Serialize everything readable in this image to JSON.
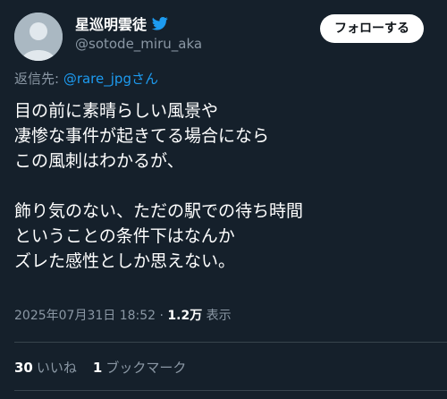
{
  "author": {
    "display_name": "星巡明雲徒",
    "handle": "@sotode_miru_aka"
  },
  "header": {
    "follow_label": "フォローする"
  },
  "reply": {
    "prefix": "返信先: ",
    "target": "@rare_jpgさん"
  },
  "body": {
    "lines": [
      "目の前に素晴らしい風景や",
      "凄惨な事件が起きてる場合になら",
      "この風刺はわかるが、",
      "",
      "飾り気のない、ただの駅での待ち時間",
      "ということの条件下はなんか",
      "ズレた感性としか思えない。"
    ]
  },
  "meta": {
    "timestamp": "2025年07月31日 18:52",
    "separator": " · ",
    "views_count": "1.2万",
    "views_label": " 表示"
  },
  "stats": {
    "likes_count": "30",
    "likes_label": "いいね",
    "bookmarks_count": "1",
    "bookmarks_label": "ブックマーク"
  },
  "icons": {
    "avatar": "default-avatar-icon",
    "bird": "twitter-bird-icon"
  },
  "colors": {
    "background": "#15202b",
    "accent": "#1d9bf0",
    "muted": "#8b98a5"
  }
}
